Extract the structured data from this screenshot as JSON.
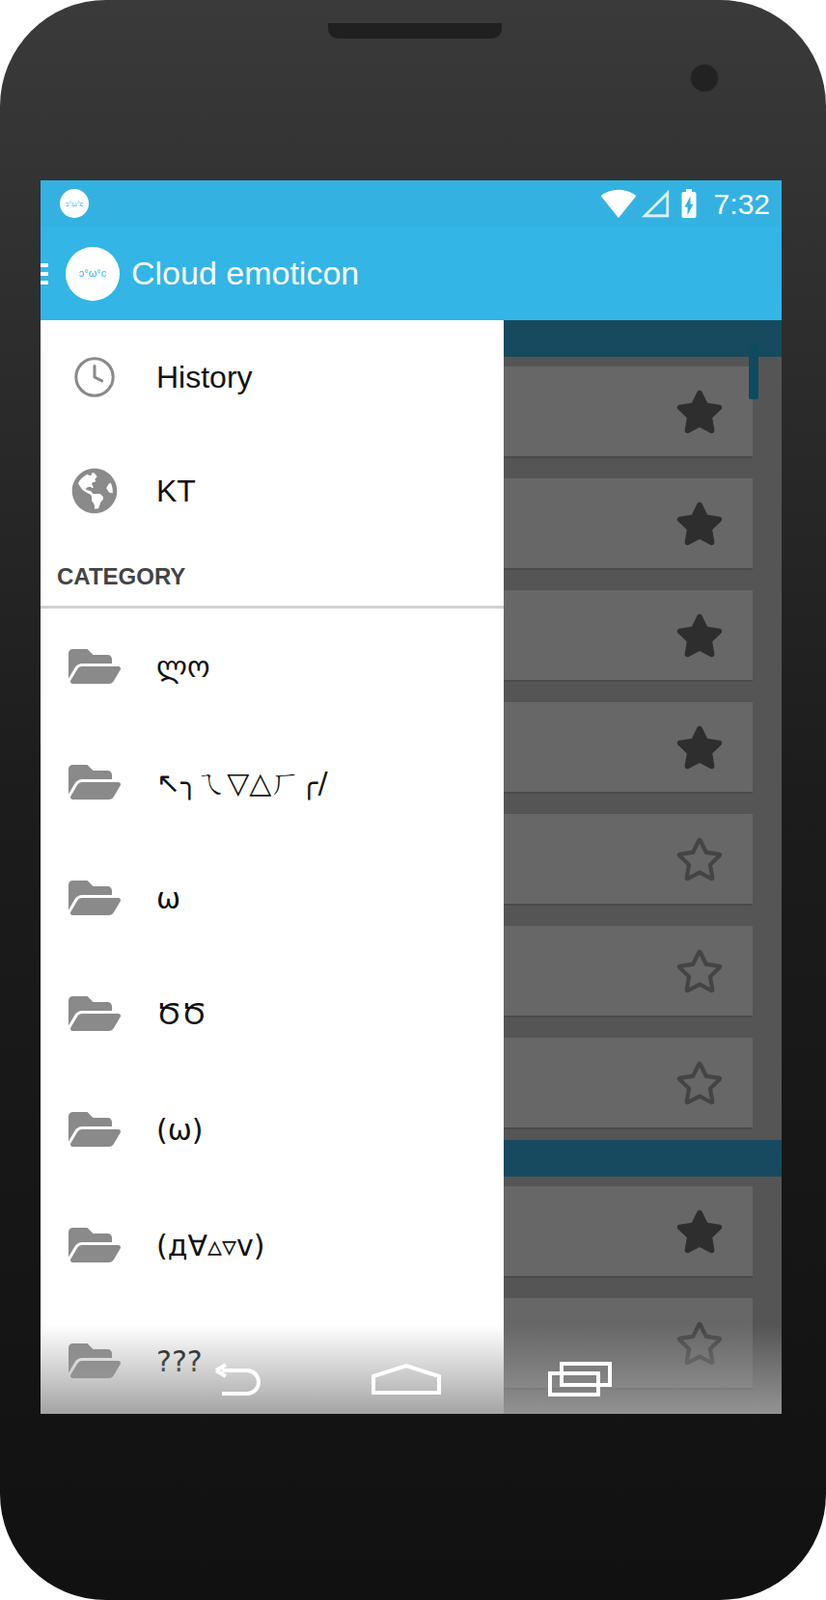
{
  "status_bar": {
    "app_icon": "ɔ°ω°c",
    "time": "7:32"
  },
  "app_bar": {
    "logo": "ɔ°ω°c",
    "title": "Cloud emoticon"
  },
  "drawer": {
    "items": [
      {
        "label": "History",
        "kind": "history"
      },
      {
        "label": "KT",
        "kind": "globe"
      }
    ],
    "category_header": "CATEGORY",
    "categories": [
      "ლო",
      "↖╮ㄟ▽△ㄏ╭/",
      "ω",
      "ԾԾ",
      "(ω)",
      "(д∀▵▿v)",
      "???"
    ]
  },
  "content": {
    "sections": [
      {
        "items": [
          {
            "starred": true
          },
          {
            "starred": true
          },
          {
            "starred": true
          },
          {
            "starred": true
          },
          {
            "starred": false
          },
          {
            "starred": false
          },
          {
            "starred": false
          }
        ]
      },
      {
        "items": [
          {
            "starred": true
          },
          {
            "starred": false
          }
        ]
      }
    ]
  }
}
